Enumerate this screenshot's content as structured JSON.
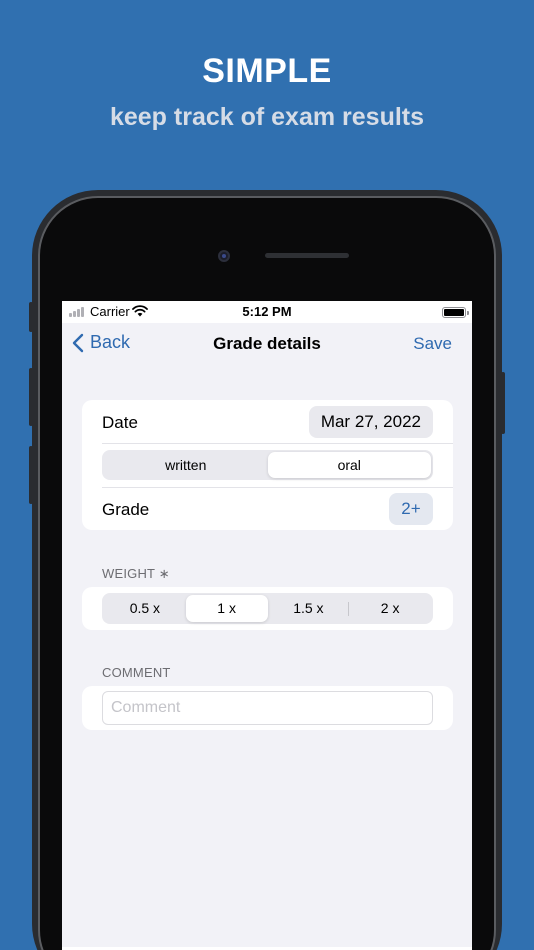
{
  "promo": {
    "title": "SIMPLE",
    "subtitle": "keep track of exam results"
  },
  "status_bar": {
    "carrier": "Carrier",
    "time": "5:12 PM"
  },
  "nav": {
    "back_label": "Back",
    "title": "Grade details",
    "save_label": "Save"
  },
  "details": {
    "date_label": "Date",
    "date_value": "Mar 27, 2022",
    "type_options": [
      "written",
      "oral"
    ],
    "type_selected": "oral",
    "grade_label": "Grade",
    "grade_value": "2+"
  },
  "weight": {
    "header": "WEIGHT ∗",
    "options": [
      "0.5 x",
      "1 x",
      "1.5 x",
      "2 x"
    ],
    "selected": "1 x"
  },
  "comment": {
    "header": "COMMENT",
    "placeholder": "Comment",
    "value": ""
  },
  "colors": {
    "background": "#3070B0",
    "accent": "#2f6ab0",
    "screen_background": "#F2F2F7"
  },
  "icons": [
    "chevron-left-icon",
    "wifi-icon",
    "signal-icon",
    "battery-icon"
  ]
}
